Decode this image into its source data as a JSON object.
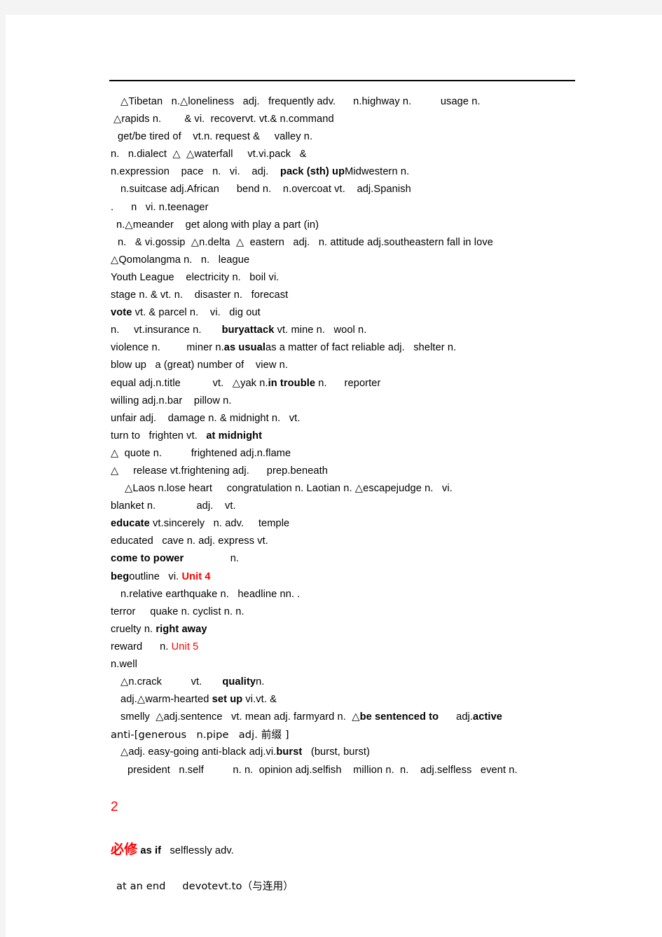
{
  "document": {
    "page_background": "#ffffff",
    "canvas_background": "#f4f4f4",
    "accent_red": "#ff0000",
    "text_color": "#000000",
    "horizontal_rule": true,
    "lines": [
      {
        "id": "l1",
        "indent": 24,
        "text": "△Tibetan   n.△loneliness   adj.   frequently adv.      n.highway n.          usage n."
      },
      {
        "id": "l2",
        "indent": 14,
        "text": "△rapids n.        & vi.  recovervt. vt.& n.command"
      },
      {
        "id": "l3",
        "indent": 20,
        "text": "get/be tired of    vt.n. request &     valley n."
      },
      {
        "id": "l4",
        "indent": 10,
        "text": "n.   n.dialect  △  △waterfall     vt.vi.pack   &"
      },
      {
        "id": "l5",
        "indent": 110,
        "text": "n.expression    pace   n.   vi.    adj.    ",
        "bold_from": "pack (sth) up",
        "tail": "Midwestern n."
      },
      {
        "id": "l6",
        "indent": 24,
        "text": "n.suitcase adj.African      bend n.    n.overcoat vt.    adj.Spanish"
      },
      {
        "id": "l7",
        "indent": 90,
        "text": ".      n   vi. n.teenager"
      },
      {
        "id": "l8",
        "indent": 18,
        "text": "n.△meander    get along with play a part (in)"
      },
      {
        "id": "l9",
        "indent": 20,
        "text": "n.   & vi.gossip  △n.delta  △  eastern   adj.   n. attitude adj.southeastern fall in love"
      },
      {
        "id": "l10",
        "indent": 10,
        "text": "△Qomolangma n.   n.   league"
      },
      {
        "id": "l11",
        "indent": 10,
        "text": "Youth League    electricity n.   boil vi."
      },
      {
        "id": "l12",
        "indent": 10,
        "text": "stage n. & vt. n.    disaster n.   forecast"
      },
      {
        "id": "l13",
        "indent": 10,
        "bold_head": "vote",
        "text": " vt. & parcel n.    vi.   dig out"
      },
      {
        "id": "l14",
        "indent": 10,
        "text": "n.     vt.insurance n.       ",
        "bold_mid": "buryattack",
        "tail2": " vt. mine n.   wool n."
      },
      {
        "id": "l15",
        "indent": 10,
        "text": "violence n.         miner n.",
        "bold_mid": "as usual",
        "tail2": "as a matter of fact reliable adj.   shelter n."
      },
      {
        "id": "l16",
        "indent": 10,
        "text": "blow up   a (great) number of    view n."
      },
      {
        "id": "l17",
        "indent": 10,
        "text": "equal adj.n.title           vt.   △yak n.",
        "bold_mid": "in trouble",
        "tail2": " n.      reporter"
      },
      {
        "id": "l18",
        "indent": 10,
        "text": "willing adj.n.bar    pillow n."
      },
      {
        "id": "l19",
        "indent": 10,
        "text": "unfair adj.    damage n. & midnight n.   vt."
      },
      {
        "id": "l20",
        "indent": 10,
        "text": "turn to   frighten vt.   ",
        "bold_tail": "at midnight"
      },
      {
        "id": "l21",
        "indent": 10,
        "text": "△  quote n.          frightened adj.n.flame"
      },
      {
        "id": "l22",
        "indent": 10,
        "text": "△     release vt.frightening adj.      prep.beneath"
      },
      {
        "id": "l23",
        "indent": 30,
        "text": "△Laos n.lose heart     congratulation n. Laotian n. △escapejudge n.   vi."
      },
      {
        "id": "l24",
        "indent": 10,
        "text": "blanket n.              adj.    vt."
      },
      {
        "id": "l25",
        "indent": 10,
        "bold_head": "educate",
        "text": " vt.sincerely   n. adv.     temple"
      },
      {
        "id": "l26",
        "indent": 10,
        "text": "educated   cave n. adj. express vt."
      },
      {
        "id": "l27",
        "indent": 10,
        "bold_head": "come to power",
        "text": "                n."
      },
      {
        "id": "l28",
        "indent": 10,
        "bold_head": "beg",
        "text": "outline   vi. ",
        "red_tail": "Unit 4"
      },
      {
        "id": "l29",
        "indent": 24,
        "text": "n.relative earthquake n.   headline nn. ."
      },
      {
        "id": "l30",
        "indent": 10,
        "text": "terror     quake n. cyclist n. n."
      },
      {
        "id": "l31",
        "indent": 10,
        "text": "cruelty n. ",
        "bold_tail": "right away"
      },
      {
        "id": "l32",
        "indent": 10,
        "text": "reward      n. ",
        "red_tail": "Unit 5"
      },
      {
        "id": "l33",
        "indent": 10,
        "text": "n.well"
      },
      {
        "id": "l34",
        "indent": 24,
        "text": "△n.crack          vt.       ",
        "bold_mid": "quality",
        "tail2": "n."
      },
      {
        "id": "l35",
        "indent": 24,
        "text": "adj.△warm-hearted ",
        "bold_mid": "set up",
        "tail2": " vi.vt. &"
      },
      {
        "id": "l36",
        "indent": 24,
        "text": "smelly  △adj.sentence   vt. mean adj. farmyard n.  △",
        "bold_mid": "be sentenced to",
        "tail2": "      adj.",
        "bold_tail2": "active"
      },
      {
        "id": "l37",
        "indent": 10,
        "text": "anti-[generous   n.pipe   adj. 前缀 ]"
      },
      {
        "id": "l38",
        "indent": 24,
        "text": "△adj. easy-going anti-black adj.vi.",
        "bold_mid": "burst",
        "tail2": "   (burst, burst)"
      },
      {
        "id": "l39",
        "indent": 34,
        "text": "president   n.self          n. n.  opinion adj.selfish    million n.  n.    adj.selfless   event n."
      }
    ],
    "page_number": "2",
    "footer_lines": [
      {
        "id": "f1",
        "indent": 10,
        "cjk_red": "必修",
        "bold_part": " as if",
        "text": "   selflessly adv."
      },
      {
        "id": "f2",
        "indent": 18,
        "text": "at an end     devotevt.to（与连用）"
      }
    ]
  }
}
